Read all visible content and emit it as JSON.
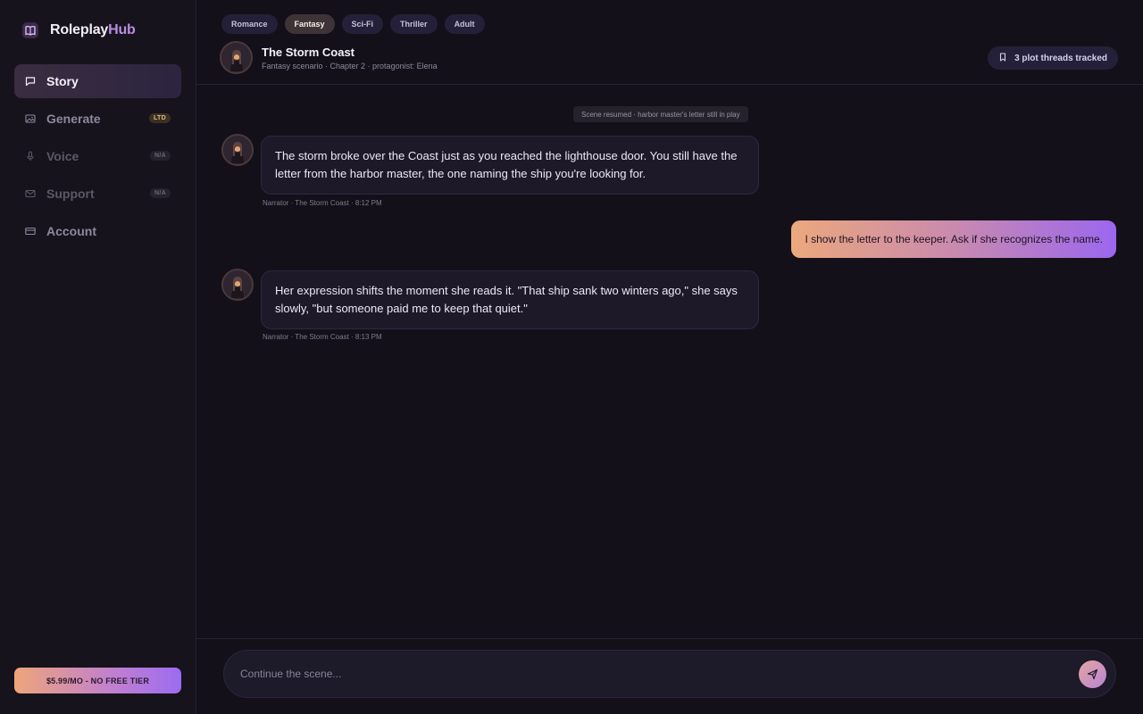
{
  "app": {
    "brand_main": "Roleplay",
    "brand_accent": "Hub",
    "accent_color": "#b98ee0"
  },
  "sidebar": {
    "items": [
      {
        "label": "Story",
        "icon": "chat-bubble-icon",
        "active": true,
        "badge": ""
      },
      {
        "label": "Generate",
        "icon": "image-icon",
        "active": false,
        "badge": "LTD"
      },
      {
        "label": "Voice",
        "icon": "microphone-icon",
        "active": false,
        "badge": "N/A"
      },
      {
        "label": "Support",
        "icon": "mail-icon",
        "active": false,
        "badge": "N/A"
      },
      {
        "label": "Account",
        "icon": "credit-card-icon",
        "active": false,
        "badge": ""
      }
    ],
    "pricing_label": "$5.99/MO - NO FREE TIER"
  },
  "genres": [
    {
      "label": "Romance",
      "active": false
    },
    {
      "label": "Fantasy",
      "active": true
    },
    {
      "label": "Sci-Fi",
      "active": false
    },
    {
      "label": "Thriller",
      "active": false
    },
    {
      "label": "Adult",
      "active": false
    }
  ],
  "story": {
    "title": "The Storm Coast",
    "subtitle": "Fantasy scenario · Chapter 2 · protagonist: Elena",
    "threads_label": "3 plot threads tracked"
  },
  "chat": {
    "resume_note": "Scene resumed · harbor master's letter still in play",
    "messages": [
      {
        "role": "narrator",
        "text": "The storm broke over the Coast just as you reached the lighthouse door. You still have the letter from the harbor master, the one naming the ship you're looking for.",
        "meta": "Narrator · The Storm Coast · 8:12 PM"
      },
      {
        "role": "user",
        "text": "I show the letter to the keeper. Ask if she recognizes the name."
      },
      {
        "role": "narrator",
        "text": "Her expression shifts the moment she reads it. \"That ship sank two winters ago,\" she says slowly, \"but someone paid me to keep that quiet.\"",
        "meta": "Narrator · The Storm Coast · 8:13 PM"
      }
    ]
  },
  "composer": {
    "placeholder": "Continue the scene...",
    "value": ""
  }
}
